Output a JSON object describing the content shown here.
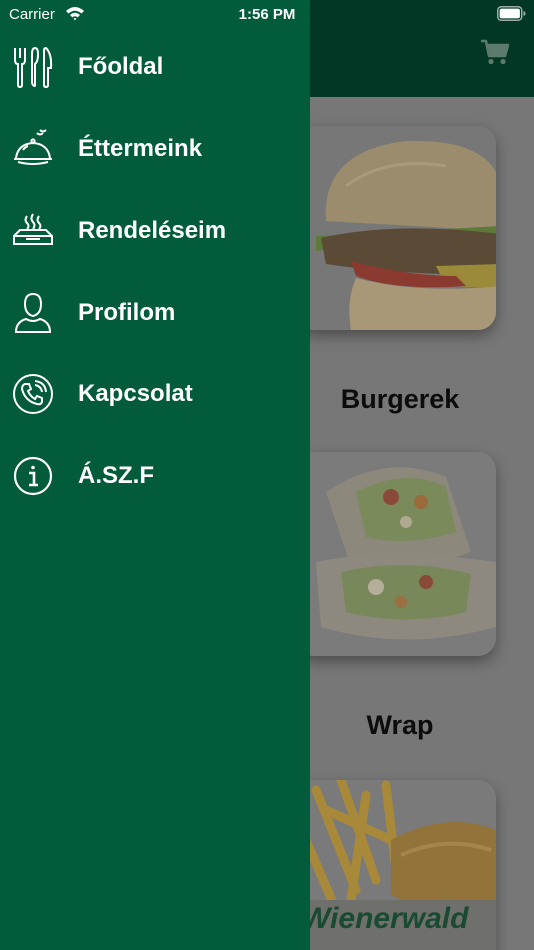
{
  "status_bar": {
    "carrier": "Carrier",
    "time": "1:56 PM"
  },
  "colors": {
    "drawer_bg": "#025b3b",
    "header_bg": "#013724",
    "overlay_bg": "#777777"
  },
  "header": {
    "cart_icon": "cart-icon"
  },
  "drawer": {
    "items": [
      {
        "label": "Főoldal",
        "icon": "utensils-icon"
      },
      {
        "label": "Éttermeink",
        "icon": "cloche-icon"
      },
      {
        "label": "Rendeléseim",
        "icon": "food-tray-icon"
      },
      {
        "label": "Profilom",
        "icon": "user-icon"
      },
      {
        "label": "Kapcsolat",
        "icon": "phone-icon"
      },
      {
        "label": "Á.SZ.F",
        "icon": "info-icon"
      }
    ]
  },
  "categories": [
    {
      "label": "Burgerek",
      "image": "burger-image"
    },
    {
      "label": "Wrap",
      "image": "wrap-image"
    },
    {
      "label": "",
      "image": "fries-image",
      "image_text": "Wienerwald"
    }
  ]
}
